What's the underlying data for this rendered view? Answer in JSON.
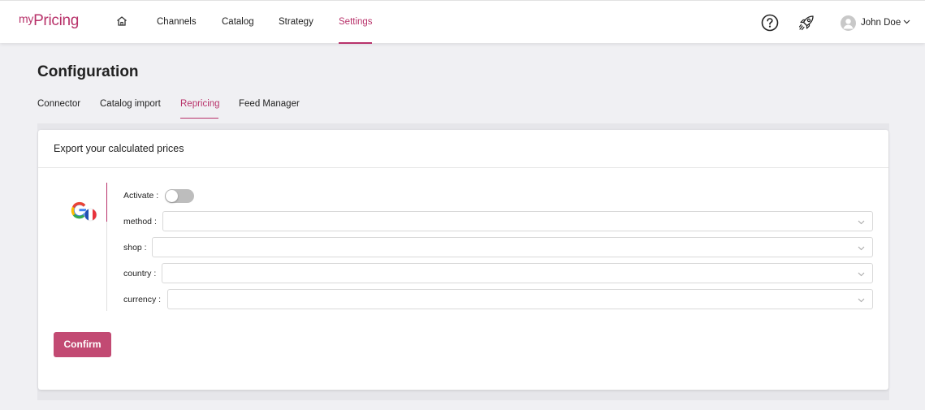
{
  "app": {
    "logo_prefix": "my",
    "logo_main": "Pricing",
    "brand_color": "#b8326a"
  },
  "nav": {
    "home_icon": "home-icon",
    "items": [
      {
        "label": "Channels",
        "active": false
      },
      {
        "label": "Catalog",
        "active": false
      },
      {
        "label": "Strategy",
        "active": false
      },
      {
        "label": "Settings",
        "active": true
      }
    ]
  },
  "header_right": {
    "help_icon": "question-circle-icon",
    "rocket_icon": "rocket-icon",
    "user_name": "John Doe"
  },
  "page": {
    "title": "Configuration",
    "tabs": [
      {
        "label": "Connector",
        "active": false
      },
      {
        "label": "Catalog import",
        "active": false
      },
      {
        "label": "Repricing",
        "active": true
      },
      {
        "label": "Feed Manager",
        "active": false
      }
    ]
  },
  "card": {
    "title": "Export your calculated prices",
    "channel_icon": "google-france-icon",
    "activate": {
      "label": "Activate :",
      "enabled": false
    },
    "fields": [
      {
        "label": "method :",
        "value": ""
      },
      {
        "label": "shop :",
        "value": ""
      },
      {
        "label": "country :",
        "value": ""
      },
      {
        "label": "currency :",
        "value": ""
      }
    ],
    "confirm_label": "Confirm",
    "button_color": "#c24a73"
  }
}
